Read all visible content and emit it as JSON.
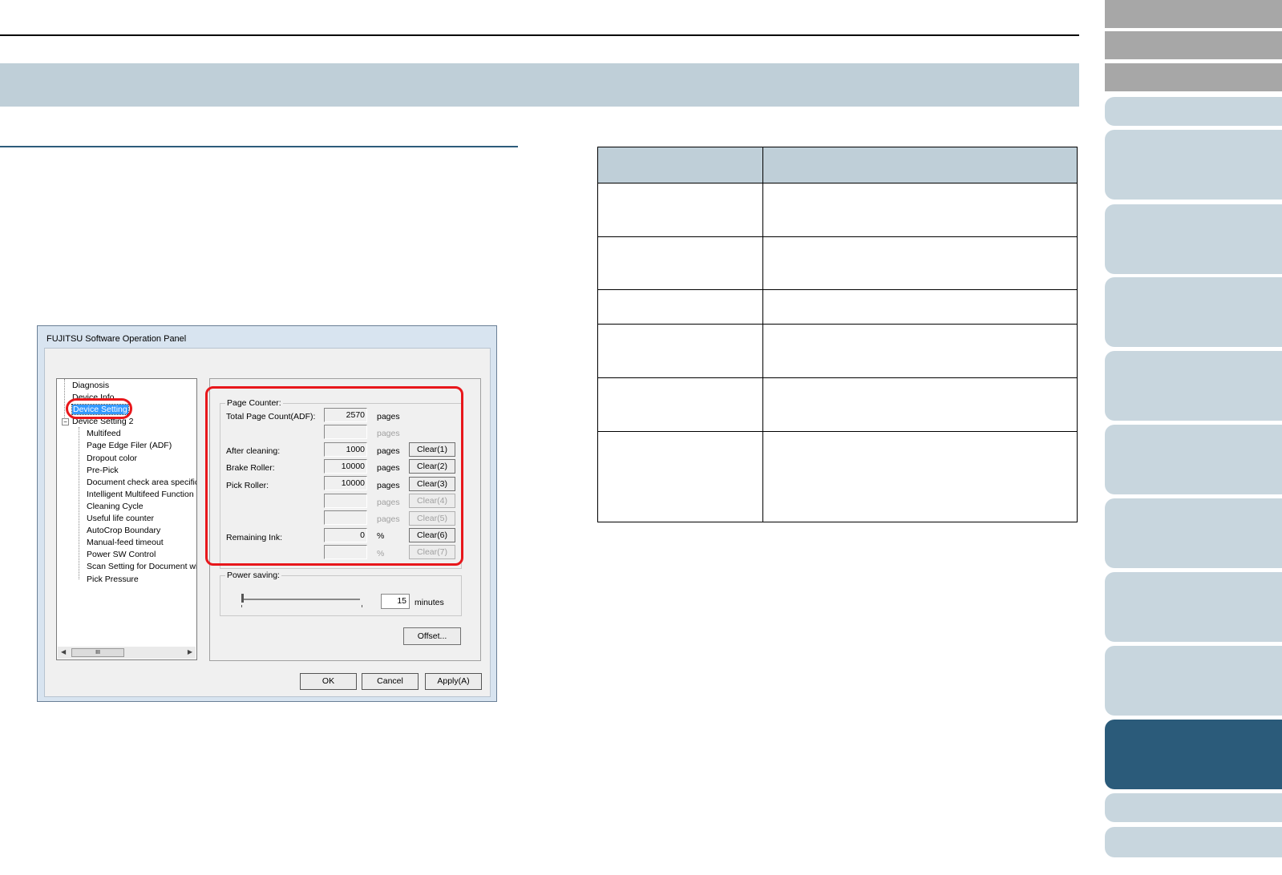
{
  "window": {
    "title": "FUJITSU Software Operation Panel"
  },
  "tree": {
    "items": [
      "Diagnosis",
      "Device Info",
      "Device Setting",
      "Device Setting 2",
      "Multifeed",
      "Page Edge Filer (ADF)",
      "Dropout color",
      "Pre-Pick",
      "Document check area specific",
      "Intelligent Multifeed Function",
      "Cleaning Cycle",
      "Useful life counter",
      "AutoCrop Boundary",
      "Manual-feed timeout",
      "Power SW Control",
      "Scan Setting for Document wit",
      "Pick Pressure"
    ],
    "expander": "−",
    "hscroll_thumb": "III"
  },
  "page_counter": {
    "legend": "Page Counter:",
    "rows": [
      {
        "label": "Total Page Count(ADF):",
        "value": "2570",
        "unit": "pages",
        "button": ""
      },
      {
        "label": "",
        "value": "",
        "unit": "pages",
        "button": ""
      },
      {
        "label": "After cleaning:",
        "value": "1000",
        "unit": "pages",
        "button": "Clear(1)"
      },
      {
        "label": "Brake Roller:",
        "value": "10000",
        "unit": "pages",
        "button": "Clear(2)"
      },
      {
        "label": "Pick Roller:",
        "value": "10000",
        "unit": "pages",
        "button": "Clear(3)"
      },
      {
        "label": "",
        "value": "",
        "unit": "pages",
        "button": "Clear(4)"
      },
      {
        "label": "",
        "value": "",
        "unit": "pages",
        "button": "Clear(5)"
      },
      {
        "label": "Remaining Ink:",
        "value": "0",
        "unit": "%",
        "button": "Clear(6)"
      },
      {
        "label": "",
        "value": "",
        "unit": "%",
        "button": "Clear(7)"
      }
    ]
  },
  "power_saving": {
    "legend": "Power saving:",
    "value": "15",
    "unit": "minutes",
    "slider_fraction": 0.0
  },
  "buttons": {
    "offset": "Offset...",
    "ok": "OK",
    "cancel": "Cancel",
    "apply": "Apply(A)"
  },
  "colors": {
    "highlight": "#e8171b",
    "title_band": "#bfcfd8",
    "active_tab": "#2b5b7a"
  }
}
